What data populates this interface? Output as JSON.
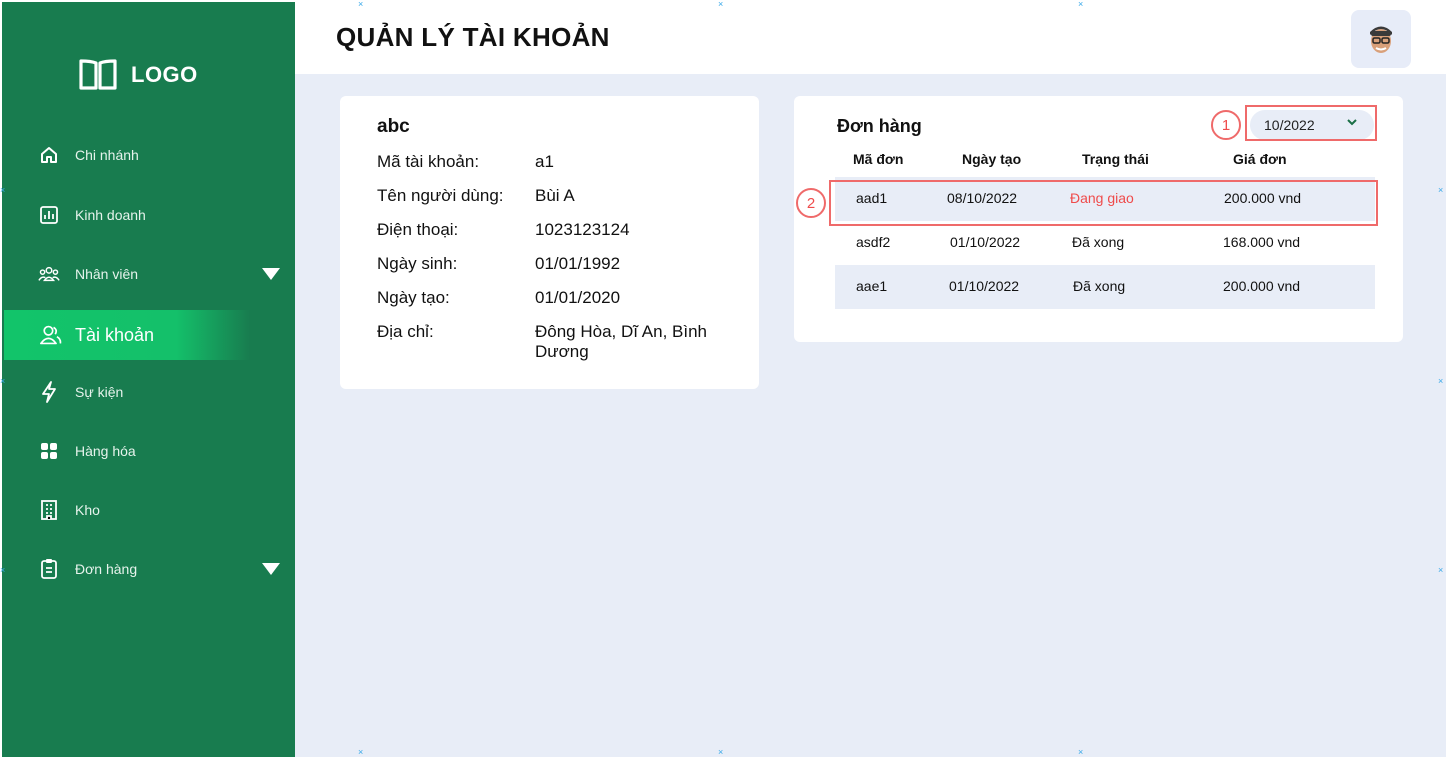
{
  "sidebar": {
    "logo_text": "LOGO",
    "items": [
      {
        "label": "Chi nhánh"
      },
      {
        "label": "Kinh doanh"
      },
      {
        "label": "Nhân viên"
      },
      {
        "label": "Tài khoản"
      },
      {
        "label": "Sự kiện"
      },
      {
        "label": "Hàng hóa"
      },
      {
        "label": "Kho"
      },
      {
        "label": "Đơn hàng"
      }
    ]
  },
  "header": {
    "title": "QUẢN LÝ TÀI KHOẢN"
  },
  "profile": {
    "name": "abc",
    "fields": [
      {
        "label": "Mã tài khoản:",
        "value": "a1"
      },
      {
        "label": "Tên người dùng:",
        "value": "Bùi A"
      },
      {
        "label": "Điện thoại:",
        "value": "1023123124"
      },
      {
        "label": "Ngày sinh:",
        "value": "01/01/1992"
      },
      {
        "label": "Ngày tạo:",
        "value": "01/01/2020"
      },
      {
        "label": "Địa chỉ:",
        "value": "Đông Hòa, Dĩ An, Bình Dương"
      }
    ]
  },
  "orders": {
    "title": "Đơn hàng",
    "month": "10/2022",
    "columns": [
      "Mã đơn",
      "Ngày tạo",
      "Trạng thái",
      "Giá đơn"
    ],
    "rows": [
      {
        "id": "aad1",
        "date": "08/10/2022",
        "status": "Đang giao",
        "price": "200.000 vnd"
      },
      {
        "id": "asdf2",
        "date": "01/10/2022",
        "status": "Đã xong",
        "price": "168.000 vnd"
      },
      {
        "id": "aae1",
        "date": "01/10/2022",
        "status": "Đã xong",
        "price": "200.000 vnd"
      }
    ]
  },
  "annotations": {
    "badge_1": "1",
    "badge_2": "2"
  },
  "colors": {
    "sidebar": "#187c4f",
    "active": "#12c46a",
    "background": "#e8edf7",
    "highlight": "#ef6a6a",
    "status_pending": "#ef4b4b"
  }
}
